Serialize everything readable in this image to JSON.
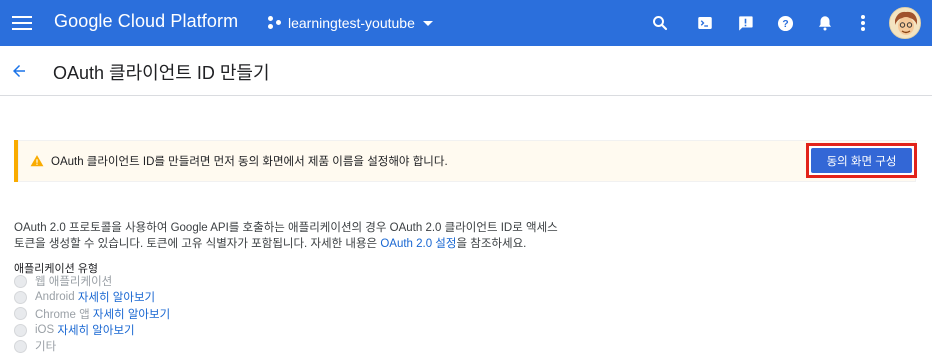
{
  "header": {
    "brand": "Google Cloud Platform",
    "project_name": "learningtest-youtube",
    "color": "#2b6fdc"
  },
  "title_bar": {
    "title": "OAuth 클라이언트 ID 만들기"
  },
  "warning": {
    "message": "OAuth 클라이언트 ID를 만들려면 먼저 동의 화면에서 제품 이름을 설정해야 합니다.",
    "button_label": "동의 화면 구성",
    "accent_color": "#f9ab00"
  },
  "description": {
    "line1": "OAuth 2.0 프로토콜을 사용하여 Google API를 호출하는 애플리케이션의 경우 OAuth 2.0 클라이언트 ID로 액세스",
    "line2_prefix": "토큰을 생성할 수 있습니다. 토큰에 고유 식별자가 포함됩니다. 자세한 내용은 ",
    "line2_link": "OAuth 2.0 설정",
    "line2_suffix": "을 참조하세요."
  },
  "app_type": {
    "label": "애플리케이션 유형",
    "options": [
      {
        "label": "웹 애플리케이션",
        "link": ""
      },
      {
        "label": "Android",
        "link": "자세히 알아보기"
      },
      {
        "label": "Chrome 앱",
        "link": "자세히 알아보기"
      },
      {
        "label": "iOS",
        "link": "자세히 알아보기"
      },
      {
        "label": "기타",
        "link": ""
      }
    ]
  },
  "icons": {
    "menu": "hamburger-menu-icon",
    "search": "search-icon",
    "terminal": "cloud-shell-icon",
    "feedback": "alert-icon",
    "help": "help-icon",
    "notifications": "bell-icon",
    "more": "more-vert-icon",
    "back": "back-arrow-icon",
    "warning": "warning-icon"
  }
}
